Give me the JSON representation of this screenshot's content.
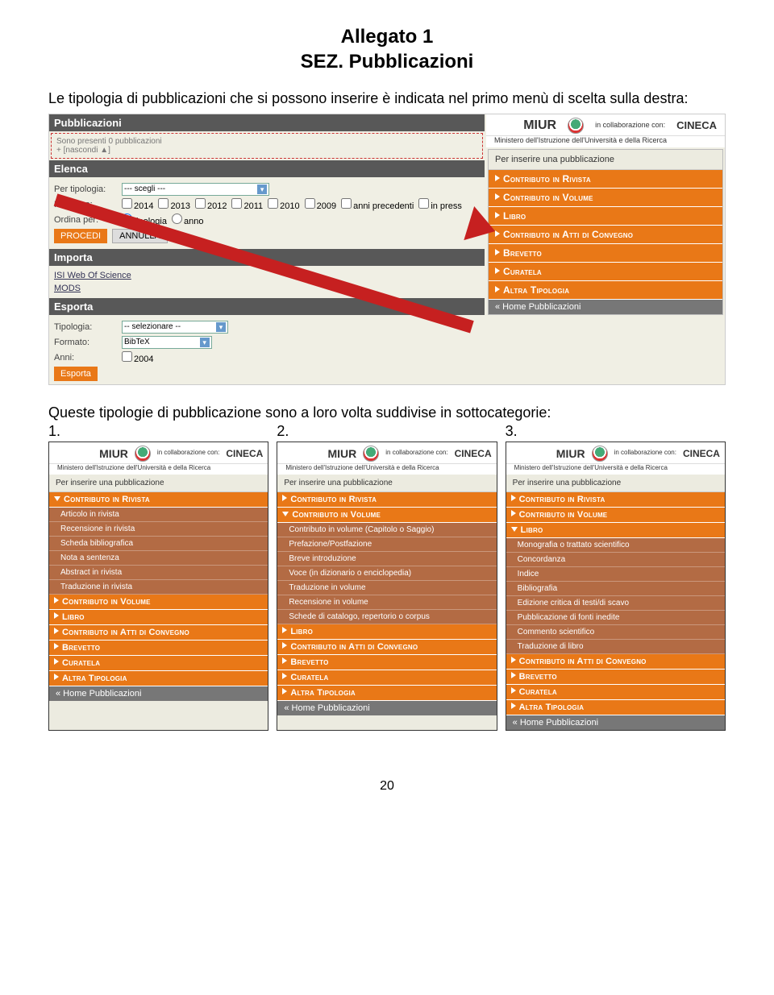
{
  "doc": {
    "title_line1": "Allegato 1",
    "title_line2": "SEZ. Pubblicazioni",
    "intro": "Le tipologia di pubblicazioni che si possono inserire è indicata nel primo menù di scelta sulla destra:",
    "caption": "Queste tipologie di pubblicazione sono a loro volta suddivise in sottocategorie:",
    "col_labels": [
      "1.",
      "2.",
      "3."
    ],
    "page_number": "20"
  },
  "miur": {
    "logo": "MIUR",
    "sub": "Ministero dell'Istruzione dell'Università e della Ricerca",
    "collab": "in collaborazione con:",
    "cineca": "CINECA"
  },
  "top_ui": {
    "pub_header": "Pubblicazioni",
    "dashed1": "Sono presenti 0 pubblicazioni",
    "dashed2": "+ [nascondi ▲]",
    "elenca": "Elenca",
    "per_tipologia": "Per tipologia:",
    "scegli": "--- scegli ---",
    "per_anno": "Per anno:",
    "years": [
      "2014",
      "2013",
      "2012",
      "2011",
      "2010",
      "2009"
    ],
    "anni_prec": "anni precedenti",
    "in_press": "in press",
    "ordina": "Ordina per:",
    "radio_tip": "tipologia",
    "radio_anno": "anno",
    "procedi": "PROCEDI",
    "annulla": "ANNULLA",
    "importa": "Importa",
    "isi": "ISI Web Of Science",
    "mods": "MODS",
    "esporta": "Esporta",
    "tipologia": "Tipologia:",
    "selezionare": "-- selezionare --",
    "formato": "Formato:",
    "bibtex": "BibTeX",
    "anni": "Anni:",
    "anno2004": "2004",
    "esporta_btn": "Esporta"
  },
  "right_panel": {
    "prompt": "Per inserire una pubblicazione",
    "cats": [
      "Contributo in Rivista",
      "Contributo in Volume",
      "Libro",
      "Contributo in Atti di Convegno",
      "Brevetto",
      "Curatela",
      "Altra Tipologia"
    ],
    "back": "« Home Pubblicazioni"
  },
  "panel1": {
    "expanded": "Contributo in Rivista",
    "subs": [
      "Articolo in rivista",
      "Recensione in rivista",
      "Scheda bibliografica",
      "Nota a sentenza",
      "Abstract in rivista",
      "Traduzione in rivista"
    ],
    "rest": [
      "Contributo in Volume",
      "Libro",
      "Contributo in Atti di Convegno",
      "Brevetto",
      "Curatela",
      "Altra Tipologia"
    ]
  },
  "panel2": {
    "top": [
      "Contributo in Rivista"
    ],
    "expanded": "Contributo in Volume",
    "subs": [
      "Contributo in volume (Capitolo o Saggio)",
      "Prefazione/Postfazione",
      "Breve introduzione",
      "Voce (in dizionario o enciclopedia)",
      "Traduzione in volume",
      "Recensione in volume",
      "Schede di catalogo, repertorio o corpus"
    ],
    "rest": [
      "Libro",
      "Contributo in Atti di Convegno",
      "Brevetto",
      "Curatela",
      "Altra Tipologia"
    ]
  },
  "panel3": {
    "top": [
      "Contributo in Rivista",
      "Contributo in Volume"
    ],
    "expanded": "Libro",
    "subs": [
      "Monografia o trattato scientifico",
      "Concordanza",
      "Indice",
      "Bibliografia",
      "Edizione critica di testi/di scavo",
      "Pubblicazione di fonti inedite",
      "Commento scientifico",
      "Traduzione di libro"
    ],
    "rest": [
      "Contributo in Atti di Convegno",
      "Brevetto",
      "Curatela",
      "Altra Tipologia"
    ]
  }
}
